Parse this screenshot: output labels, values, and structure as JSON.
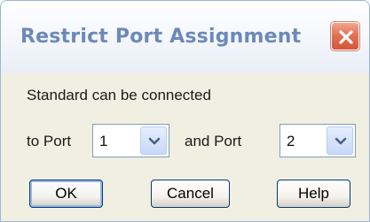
{
  "window": {
    "title": "Restrict Port Assignment",
    "close_icon": "close-icon"
  },
  "message": {
    "line1": "Standard can be connected",
    "to_port_label": "to Port",
    "and_port_label": "and Port"
  },
  "port_selects": {
    "first": {
      "value": "1",
      "icon": "chevron-down-icon"
    },
    "second": {
      "value": "2",
      "icon": "chevron-down-icon"
    }
  },
  "buttons": {
    "ok": "OK",
    "cancel": "Cancel",
    "help": "Help"
  },
  "colors": {
    "title_text": "#6d89b8",
    "close_button": "#e06f52",
    "dialog_background": "#f1efe2",
    "button_border": "#003c74"
  }
}
